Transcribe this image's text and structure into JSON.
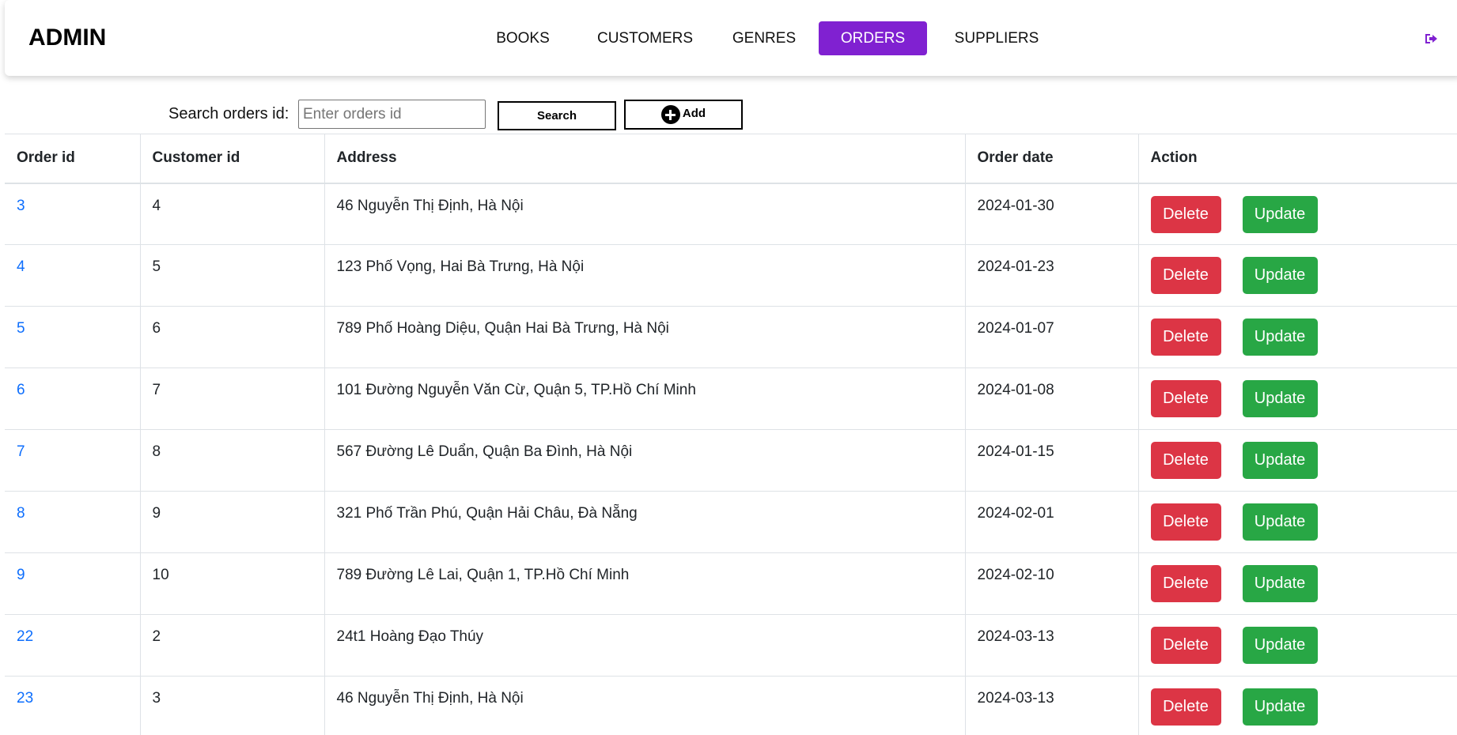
{
  "header": {
    "brand": "ADMIN",
    "nav": [
      {
        "label": "BOOKS",
        "active": false
      },
      {
        "label": "CUSTOMERS",
        "active": false
      },
      {
        "label": "GENRES",
        "active": false
      },
      {
        "label": "ORDERS",
        "active": true
      },
      {
        "label": "SUPPLIERS",
        "active": false
      }
    ],
    "logout_icon": "logout-icon",
    "accent_color": "#8021d1"
  },
  "search": {
    "label": "Search orders id:",
    "value": "",
    "placeholder": "Enter orders id",
    "search_button": "Search",
    "add_button": "Add",
    "add_icon": "plus-circle-icon"
  },
  "table": {
    "columns": [
      "Order id",
      "Customer id",
      "Address",
      "Order date",
      "Action"
    ],
    "rows": [
      {
        "order_id": "3",
        "customer_id": "4",
        "address": "46 Nguyễn Thị Định, Hà Nội",
        "order_date": "2024-01-30"
      },
      {
        "order_id": "4",
        "customer_id": "5",
        "address": "123 Phố Vọng, Hai Bà Trưng, Hà Nội",
        "order_date": "2024-01-23"
      },
      {
        "order_id": "5",
        "customer_id": "6",
        "address": "789 Phố Hoàng Diệu, Quận Hai Bà Trưng, Hà Nội",
        "order_date": "2024-01-07"
      },
      {
        "order_id": "6",
        "customer_id": "7",
        "address": "101 Đường Nguyễn Văn Cừ, Quận 5, TP.Hồ Chí Minh",
        "order_date": "2024-01-08"
      },
      {
        "order_id": "7",
        "customer_id": "8",
        "address": "567 Đường Lê Duẩn, Quận Ba Đình, Hà Nội",
        "order_date": "2024-01-15"
      },
      {
        "order_id": "8",
        "customer_id": "9",
        "address": "321 Phố Trần Phú, Quận Hải Châu, Đà Nẵng",
        "order_date": "2024-02-01"
      },
      {
        "order_id": "9",
        "customer_id": "10",
        "address": "789 Đường Lê Lai, Quận 1, TP.Hồ Chí Minh",
        "order_date": "2024-02-10"
      },
      {
        "order_id": "22",
        "customer_id": "2",
        "address": "24t1 Hoàng Đạo Thúy",
        "order_date": "2024-03-13"
      },
      {
        "order_id": "23",
        "customer_id": "3",
        "address": "46 Nguyễn Thị Định, Hà Nội",
        "order_date": "2024-03-13"
      }
    ],
    "delete_label": "Delete",
    "update_label": "Update",
    "delete_color": "#dc3545",
    "update_color": "#28a745",
    "link_color": "#0d6efd"
  }
}
